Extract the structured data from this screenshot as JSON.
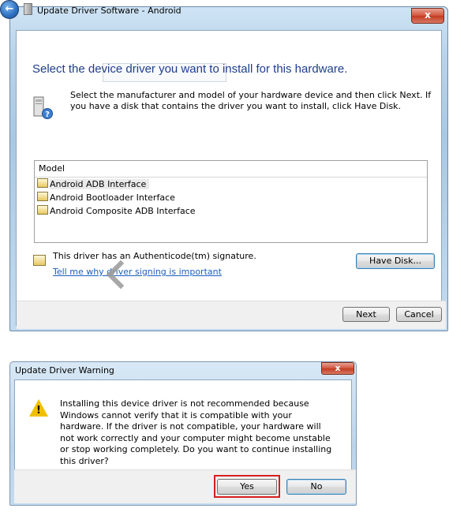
{
  "window1": {
    "title": "Update Driver Software - Android",
    "close_label": "x",
    "back_label": "←",
    "heading": "Select the device driver you want to install for this hardware.",
    "info_text": "Select the manufacturer and model of your hardware device and then click Next. If you have a disk that contains the driver you want to install, click Have Disk.",
    "list": {
      "header": "Model",
      "items": [
        {
          "label": "Android ADB Interface",
          "selected": true
        },
        {
          "label": "Android Bootloader Interface",
          "selected": false
        },
        {
          "label": "Android Composite ADB Interface",
          "selected": false
        }
      ]
    },
    "signature_text": "This driver has an Authenticode(tm) signature.",
    "signature_link": "Tell me why driver signing is important",
    "have_disk_label": "Have Disk...",
    "next_label": "Next",
    "cancel_label": "Cancel"
  },
  "window2": {
    "title": "Update Driver Warning",
    "close_label": "x",
    "message": "Installing this device driver is not recommended because Windows cannot verify that it is compatible with your hardware.  If the driver is not compatible, your hardware will not work correctly and your computer might become unstable or stop working completely.  Do you want to continue installing this driver?",
    "yes_label": "Yes",
    "no_label": "No",
    "highlight_color": "#d81e1e"
  },
  "icons": {
    "back": "back-arrow-icon",
    "hardware": "hardware-help-icon",
    "driver": "driver-certificate-icon",
    "warning": "warning-triangle-icon"
  }
}
